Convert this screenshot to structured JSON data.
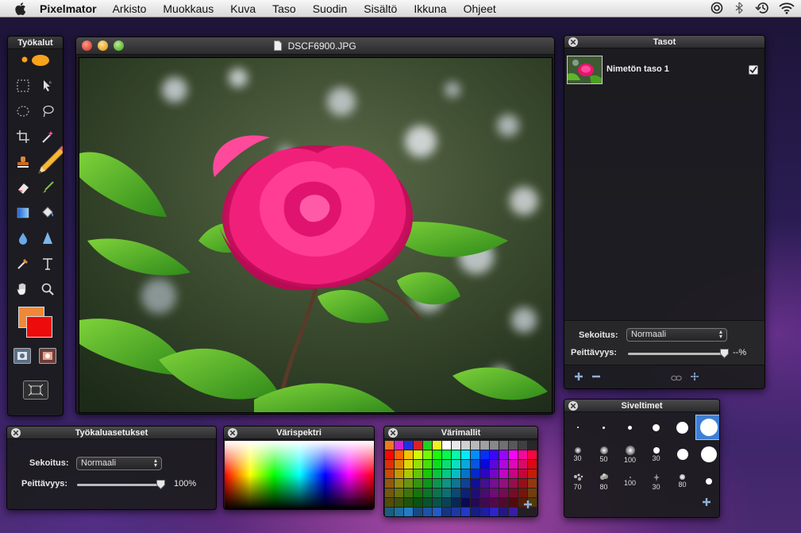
{
  "menubar": {
    "app_name": "Pixelmator",
    "items": [
      "Arkisto",
      "Muokkaus",
      "Kuva",
      "Taso",
      "Suodin",
      "Sisältö",
      "Ikkuna",
      "Ohjeet"
    ]
  },
  "tools_panel": {
    "title": "Työkalut"
  },
  "document": {
    "title": "DSCF6900.JPG"
  },
  "layers_panel": {
    "title": "Tasot",
    "layer_name": "Nimetön taso 1",
    "blend_label": "Sekoitus:",
    "blend_value": "Normaali",
    "opacity_label": "Peittävyys:",
    "opacity_value": "--%"
  },
  "tool_settings": {
    "title": "Työkaluasetukset",
    "blend_label": "Sekoitus:",
    "blend_value": "Normaali",
    "opacity_label": "Peittävyys:",
    "opacity_value": "100%",
    "opacity_fraction": 1.0
  },
  "spectrum_panel": {
    "title": "Värispektri"
  },
  "swatches_panel": {
    "title": "Värimallit"
  },
  "brushes_panel": {
    "title": "Siveltimet",
    "labels": [
      "30",
      "50",
      "100",
      "30",
      "70",
      "80",
      "100",
      "30",
      "80"
    ]
  },
  "colors": {
    "foreground": "#f0883a",
    "background": "#ee0b0b",
    "selected_brush": "#3d7fd6"
  }
}
